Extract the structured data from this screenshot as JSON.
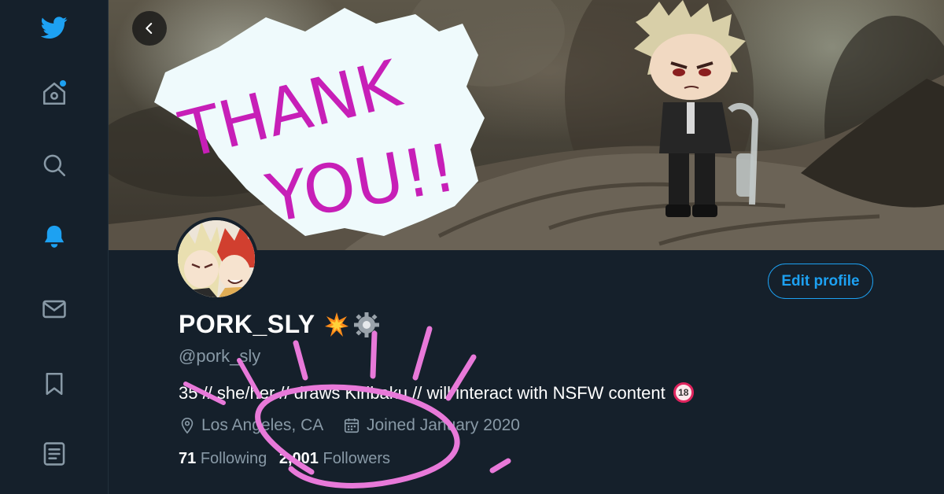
{
  "sidebar": {
    "items": [
      {
        "name": "twitter-logo",
        "icon": "twitter-bird-icon"
      },
      {
        "name": "home",
        "icon": "home-icon",
        "has_dot": true
      },
      {
        "name": "explore",
        "icon": "search-icon"
      },
      {
        "name": "notifications",
        "icon": "bell-icon"
      },
      {
        "name": "messages",
        "icon": "envelope-icon"
      },
      {
        "name": "bookmarks",
        "icon": "bookmark-icon"
      },
      {
        "name": "lists",
        "icon": "list-icon"
      }
    ],
    "accent_color": "#1da1f2"
  },
  "banner": {
    "text_line1": "THANK",
    "text_line2": "YOU!!"
  },
  "profile": {
    "display_name": "PORK_SLY",
    "name_emojis": [
      "collision-icon",
      "gear-icon"
    ],
    "handle": "@pork_sly",
    "bio": "35 // she/her // draws Kiribaku // will interact with NSFW content",
    "bio_badge": "18",
    "location": "Los Angeles, CA",
    "joined": "Joined January 2020",
    "following_count": "71",
    "following_label": "Following",
    "followers_count": "2,001",
    "followers_label": "Followers",
    "edit_button": "Edit profile"
  },
  "colors": {
    "background": "#15202b",
    "secondary_text": "#8899a6",
    "accent": "#1da1f2",
    "doodle": "#e879d9"
  }
}
